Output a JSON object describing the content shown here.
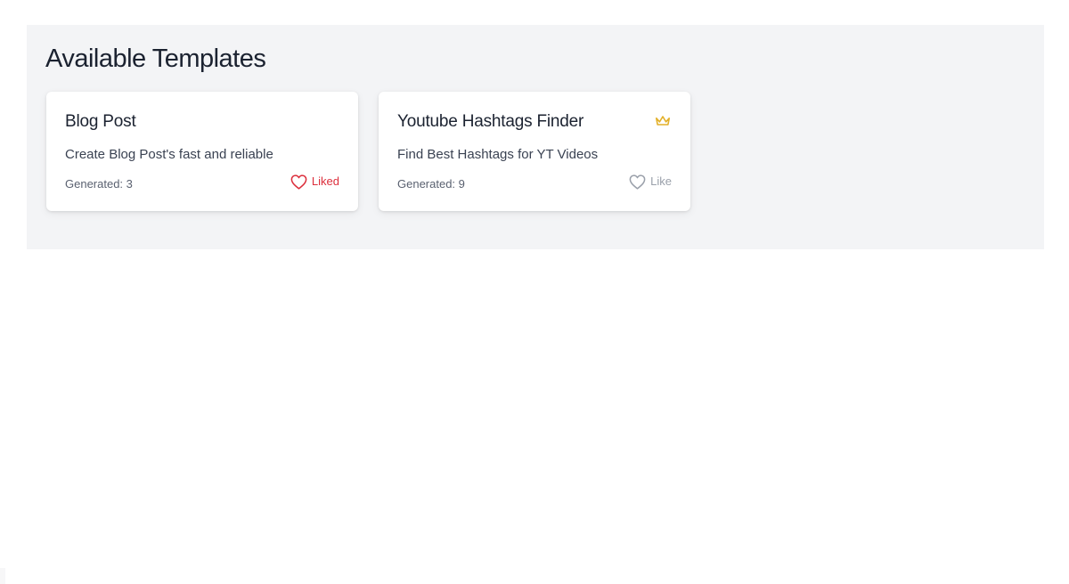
{
  "section": {
    "title": "Available Templates"
  },
  "templates": [
    {
      "title": "Blog Post",
      "description": "Create Blog Post's fast and reliable",
      "generated": "Generated: 3",
      "like_label": "Liked",
      "liked": true,
      "premium": false
    },
    {
      "title": "Youtube Hashtags Finder",
      "description": "Find Best Hashtags for YT Videos",
      "generated": "Generated: 9",
      "like_label": "Like",
      "liked": false,
      "premium": true,
      "premium_icon": "crown-icon"
    }
  ],
  "colors": {
    "panel_background": "#f3f4f6",
    "liked": "#dc2f3c",
    "unliked": "#9aa0aa",
    "crown": "#e3b12a"
  }
}
